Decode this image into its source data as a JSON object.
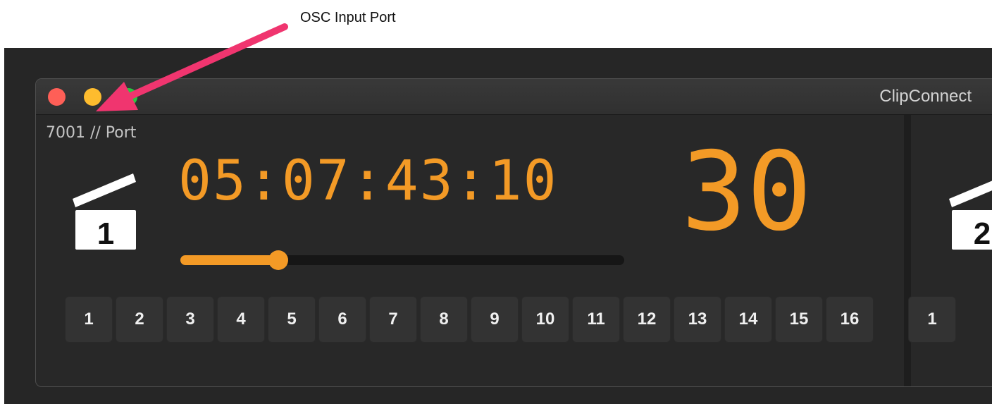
{
  "annotation": {
    "text": "OSC Input Port"
  },
  "window": {
    "title": "ClipConnect"
  },
  "deck1": {
    "port_label": "7001 // Port",
    "clip_number": "1",
    "timecode": "05:07:43:10",
    "fps": "30",
    "progress": 0.22,
    "buttons": [
      "1",
      "2",
      "3",
      "4",
      "5",
      "6",
      "7",
      "8",
      "9",
      "10",
      "11",
      "12",
      "13",
      "14",
      "15",
      "16"
    ]
  },
  "deck2": {
    "clip_number": "2",
    "buttons": [
      "1"
    ]
  },
  "colors": {
    "accent": "#f39a26",
    "close": "#fe5f57",
    "minimize": "#febc2e",
    "zoom": "#28c840",
    "arrow": "#f0356f"
  }
}
